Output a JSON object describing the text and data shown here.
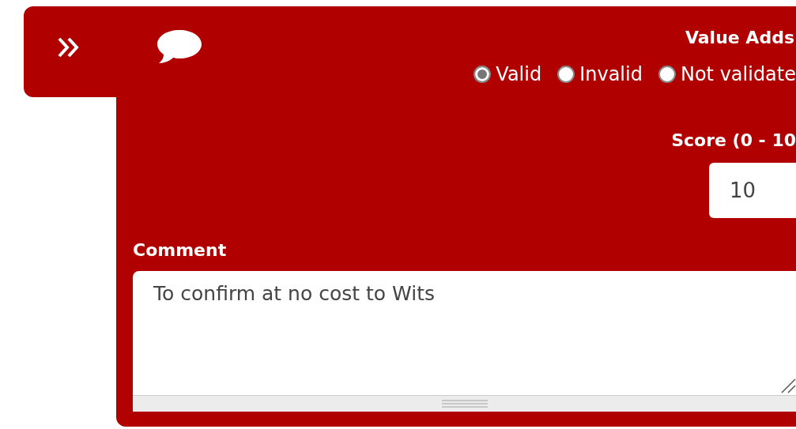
{
  "section_title": "Value Adds",
  "validation": [
    {
      "label": "Valid",
      "selected": true
    },
    {
      "label": "Invalid",
      "selected": false
    },
    {
      "label": "Not validate",
      "selected": false
    }
  ],
  "score": {
    "label": "Score (0 - 10",
    "value": "10"
  },
  "comment": {
    "label": "Comment",
    "value": "To confirm at no cost to Wits"
  }
}
